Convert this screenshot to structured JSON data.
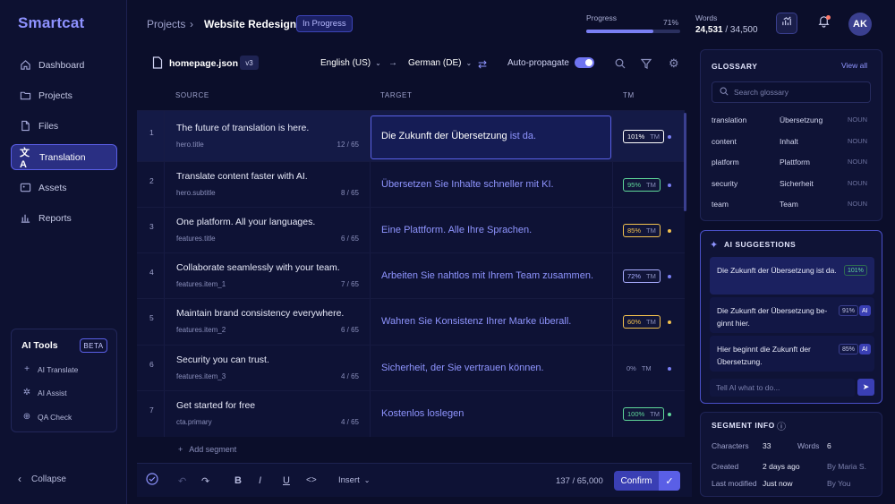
{
  "app": {
    "name": "Smartcat"
  },
  "sidebar": {
    "items": [
      {
        "label": "Dashboard",
        "icon": "home-icon"
      },
      {
        "label": "Projects",
        "icon": "folder-icon"
      },
      {
        "label": "Files",
        "icon": "file-icon"
      },
      {
        "label": "Translation",
        "icon": "translate-icon"
      },
      {
        "label": "Assets",
        "icon": "image-icon"
      },
      {
        "label": "Reports",
        "icon": "bar-chart-icon"
      }
    ],
    "active": "Translation",
    "ai_tools": {
      "title": "AI Tools",
      "badge": "BETA",
      "items": [
        {
          "label": "AI Translate",
          "icon": "plus-icon"
        },
        {
          "label": "AI Assist",
          "icon": "sparkle-icon"
        },
        {
          "label": "QA Check",
          "icon": "crosshair-icon"
        }
      ]
    },
    "collapse_label": "Collapse"
  },
  "header": {
    "breadcrumb_root": "Projects",
    "breadcrumb_current": "Website Redesign",
    "status": "In Progress",
    "progress_label": "Progress",
    "progress_value": "71%",
    "progress_fraction": 0.71,
    "words_label": "Words",
    "words_done": "24,531",
    "words_total": " / 34,500",
    "avatar_initials": "AK"
  },
  "editor": {
    "file_name": "homepage.json",
    "version": "v3",
    "source_lang": "English (US)",
    "target_lang": "German (DE)",
    "auto_propagate_label": "Auto-propagate",
    "auto_propagate_on": true,
    "columns": {
      "source": "SOURCE",
      "target": "TARGET",
      "tm": "TM"
    },
    "segments": [
      {
        "num": "1",
        "source": "The future of translation is here.",
        "key": "hero.title",
        "count": "12 / 65",
        "target_main": "Die Zukunft der Übersetzung ",
        "target_hl": "ist da.",
        "tm": "101%",
        "tm_color": "#ffffff",
        "dot": "#7a7ff5",
        "selected": true
      },
      {
        "num": "2",
        "source": "Translate content faster with AI.",
        "key": "hero.subtitle",
        "count": "8 / 65",
        "target_main": "Übersetzen Sie Inhalte schneller mit KI.",
        "target_hl": "",
        "tm": "95%",
        "tm_color": "#5fd89a",
        "dot": "#7a7ff5"
      },
      {
        "num": "3",
        "source": "One platform. All your languages.",
        "key": "features.title",
        "count": "6 / 65",
        "target_main": "Eine Plattform. Alle Ihre Sprachen.",
        "target_hl": "",
        "tm": "85%",
        "tm_color": "#f2c14e",
        "dot": "#f2c14e"
      },
      {
        "num": "4",
        "source": "Collaborate seamlessly with your team.",
        "key": "features.item_1",
        "count": "7 / 65",
        "target_main": "Arbeiten Sie nahtlos mit Ihrem Team zusammen.",
        "target_hl": "",
        "tm": "72%",
        "tm_color": "#a9adff",
        "dot": "#7a7ff5"
      },
      {
        "num": "5",
        "source": "Maintain brand consistency everywhere.",
        "key": "features.item_2",
        "count": "6 / 65",
        "target_main": "Wahren Sie Konsistenz Ihrer Marke überall.",
        "target_hl": "",
        "tm": "60%",
        "tm_color": "#f2c14e",
        "dot": "#f2c14e"
      },
      {
        "num": "6",
        "source": "Security you can trust.",
        "key": "features.item_3",
        "count": "4 / 65",
        "target_main": "Sicherheit, der Sie vertrauen können.",
        "target_hl": "",
        "tm": "0%",
        "tm_color": "#8a8fbc",
        "dot": "#7a7ff5"
      },
      {
        "num": "7",
        "source": "Get started for free",
        "key": "cta.primary",
        "count": "4 / 65",
        "target_main": "Kostenlos loslegen",
        "target_hl": "",
        "tm": "100%",
        "tm_color": "#5fd89a",
        "dot": "#5fd89a"
      }
    ],
    "tm_tag": "TM",
    "add_segment": "Add segment"
  },
  "toolbar": {
    "insert_label": "Insert",
    "counter": "137 / 65,000",
    "confirm_label": "Confirm"
  },
  "glossary": {
    "title": "GLOSSARY",
    "view_all": "View all",
    "search_placeholder": "Search glossary",
    "terms": [
      {
        "source": "translation",
        "target": "Übersetzung",
        "pos": "NOUN"
      },
      {
        "source": "content",
        "target": "Inhalt",
        "pos": "NOUN"
      },
      {
        "source": "platform",
        "target": "Plattform",
        "pos": "NOUN"
      },
      {
        "source": "security",
        "target": "Sicherheit",
        "pos": "NOUN"
      },
      {
        "source": "team",
        "target": "Team",
        "pos": "NOUN"
      }
    ]
  },
  "ai_suggestions": {
    "title": "AI SUGGESTIONS",
    "items": [
      {
        "text": "Die Zukunft der Übersetzung ist da.",
        "pct": "101%",
        "ai": ""
      },
      {
        "text": "Die Zukunft der Übersetzung be-ginnt hier.",
        "pct": "91%",
        "ai": "AI"
      },
      {
        "text": "Hier beginnt die Zukunft der Übersetzung.",
        "pct": "85%",
        "ai": "AI"
      }
    ],
    "ask_placeholder": "Tell AI what to do..."
  },
  "segment_info": {
    "title": "SEGMENT INFO",
    "characters_label": "Characters",
    "characters": "33",
    "words_label": "Words",
    "words": "6",
    "created_label": "Created",
    "created": "2 days ago",
    "created_by": "By Maria S.",
    "modified_label": "Last modified",
    "modified": "Just now",
    "modified_by": "By You"
  },
  "colors": {
    "accent": "#5a5fe6",
    "bg": "#0b0e2a",
    "panel": "#0f1336"
  }
}
